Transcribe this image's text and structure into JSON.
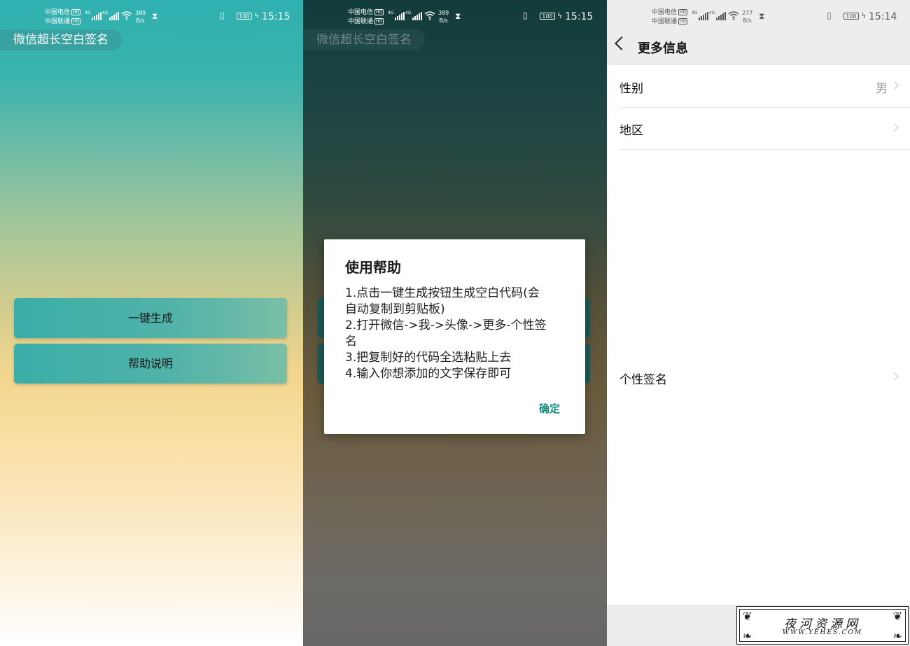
{
  "status_bars": [
    {
      "carrier1": "中国电信",
      "carrier2": "中国联通",
      "hd": "HD",
      "net": "4G",
      "speed": "389",
      "speed_unit": "B/s",
      "battery": "100",
      "time": "15:15"
    },
    {
      "carrier1": "中国电信",
      "carrier2": "中国联通",
      "hd": "HD",
      "net": "4G",
      "speed": "389",
      "speed_unit": "B/s",
      "battery": "100",
      "time": "15:15"
    },
    {
      "carrier1": "中国电信",
      "carrier2": "中国联通",
      "hd": "HD",
      "net": "4G",
      "speed": "277",
      "speed_unit": "B/s",
      "battery": "100",
      "time": "15:14"
    }
  ],
  "app": {
    "title": "微信超长空白签名",
    "generate_button": "一键生成",
    "help_button": "帮助说明"
  },
  "dialog": {
    "title": "使用帮助",
    "lines": [
      "1.点击一键生成按钮生成空白代码(会",
      "自动复制到剪贴板)",
      "2.打开微信->我->头像->更多-个性签",
      "名",
      "3.把复制好的代码全选粘贴上去",
      "4.输入你想添加的文字保存即可"
    ],
    "ok": "确定"
  },
  "more_info": {
    "title": "更多信息",
    "rows": [
      {
        "label": "性别",
        "value": "男"
      },
      {
        "label": "地区",
        "value": ""
      },
      {
        "label": "个性签名",
        "value": ""
      }
    ]
  },
  "watermark": {
    "title": "夜河资源网",
    "url": "WWW.YEHES.COM"
  },
  "colors": {
    "accent_teal": "#3aaea8",
    "dialog_ok": "#138a7a"
  }
}
